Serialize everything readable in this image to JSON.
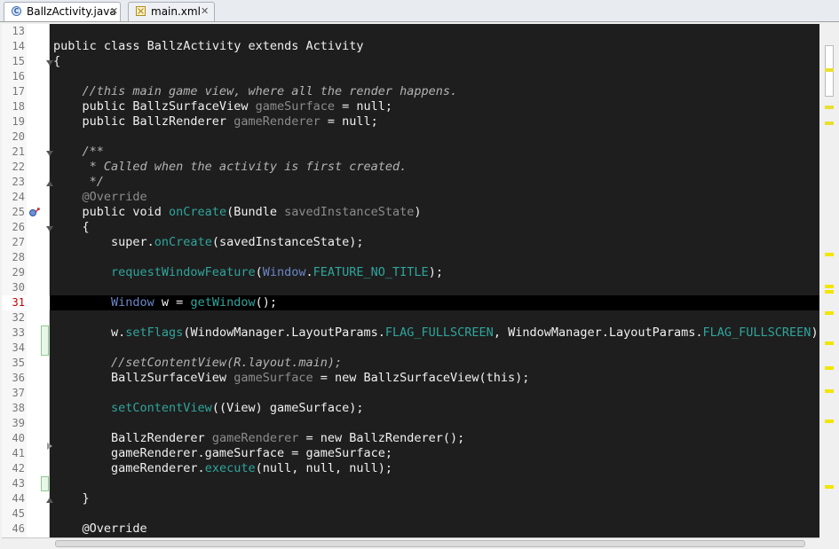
{
  "tabs": [
    {
      "label": "BallzActivity.java",
      "close": "✕",
      "icon": "java-class-icon",
      "active": true
    },
    {
      "label": "main.xml",
      "close": "✕",
      "icon": "xml-file-icon",
      "active": false
    }
  ],
  "current_line": "31",
  "lines": [
    {
      "n": "13",
      "code": []
    },
    {
      "n": "14",
      "code": [
        [
          "",
          "public class "
        ],
        [
          "",
          "BallzActivity"
        ],
        [
          "",
          " extends Activity"
        ]
      ]
    },
    {
      "n": "15",
      "code": [
        [
          "",
          "{"
        ]
      ]
    },
    {
      "n": "16",
      "code": []
    },
    {
      "n": "17",
      "code": [
        [
          "comment",
          "    //this main game view, where all the render happens."
        ]
      ]
    },
    {
      "n": "18",
      "code": [
        [
          "",
          "    public BallzSurfaceView "
        ],
        [
          "field",
          "gameSurface"
        ],
        [
          "",
          " = null;"
        ]
      ]
    },
    {
      "n": "19",
      "code": [
        [
          "",
          "    public BallzRenderer "
        ],
        [
          "field",
          "gameRenderer"
        ],
        [
          "",
          " = null;"
        ]
      ]
    },
    {
      "n": "20",
      "code": []
    },
    {
      "n": "21",
      "code": [
        [
          "comment",
          "    /**"
        ]
      ]
    },
    {
      "n": "22",
      "code": [
        [
          "comment",
          "     * Called when the activity is first created."
        ]
      ]
    },
    {
      "n": "23",
      "code": [
        [
          "comment",
          "     */"
        ]
      ]
    },
    {
      "n": "24",
      "code": [
        [
          "field",
          "    @Override"
        ]
      ]
    },
    {
      "n": "25",
      "code": [
        [
          "",
          "    public void "
        ],
        [
          "method",
          "onCreate"
        ],
        [
          "",
          "(Bundle "
        ],
        [
          "field",
          "savedInstanceState"
        ],
        [
          "",
          ")"
        ]
      ]
    },
    {
      "n": "26",
      "code": [
        [
          "",
          "    {"
        ]
      ]
    },
    {
      "n": "27",
      "code": [
        [
          "",
          "        super."
        ],
        [
          "method",
          "onCreate"
        ],
        [
          "",
          "(savedInstanceState);"
        ]
      ]
    },
    {
      "n": "28",
      "code": []
    },
    {
      "n": "29",
      "code": [
        [
          "method",
          "        requestWindowFeature"
        ],
        [
          "",
          "("
        ],
        [
          "type",
          "Window"
        ],
        [
          "",
          "."
        ],
        [
          "const",
          "FEATURE_NO_TITLE"
        ],
        [
          "",
          ");"
        ]
      ]
    },
    {
      "n": "30",
      "code": []
    },
    {
      "n": "31",
      "code": [
        [
          "type",
          "        Window"
        ],
        [
          "",
          " w = "
        ],
        [
          "method",
          "getWindow"
        ],
        [
          "",
          "();"
        ]
      ]
    },
    {
      "n": "32",
      "code": []
    },
    {
      "n": "33",
      "code": [
        [
          "",
          "        w."
        ],
        [
          "method",
          "setFlags"
        ],
        [
          "",
          "(WindowManager.LayoutParams."
        ],
        [
          "const",
          "FLAG_FULLSCREEN"
        ],
        [
          "",
          ", WindowManager.LayoutParams."
        ],
        [
          "const",
          "FLAG_FULLSCREEN"
        ],
        [
          "",
          ");"
        ]
      ]
    },
    {
      "n": "34",
      "code": []
    },
    {
      "n": "35",
      "code": [
        [
          "comment",
          "        //setContentView(R.layout.main);"
        ]
      ]
    },
    {
      "n": "36",
      "code": [
        [
          "",
          "        BallzSurfaceView "
        ],
        [
          "field",
          "gameSurface"
        ],
        [
          "",
          " = new BallzSurfaceView(this);"
        ]
      ]
    },
    {
      "n": "37",
      "code": []
    },
    {
      "n": "38",
      "code": [
        [
          "method",
          "        setContentView"
        ],
        [
          "",
          "((View) gameSurface);"
        ]
      ]
    },
    {
      "n": "39",
      "code": []
    },
    {
      "n": "40",
      "code": [
        [
          "",
          "        BallzRenderer "
        ],
        [
          "field",
          "gameRenderer"
        ],
        [
          "",
          " = new BallzRenderer();"
        ]
      ]
    },
    {
      "n": "41",
      "code": [
        [
          "",
          "        gameRenderer.gameSurface = gameSurface;"
        ]
      ]
    },
    {
      "n": "42",
      "code": [
        [
          "",
          "        gameRenderer."
        ],
        [
          "method",
          "execute"
        ],
        [
          "",
          "(null, null, null);"
        ]
      ]
    },
    {
      "n": "43",
      "code": []
    },
    {
      "n": "44",
      "code": [
        [
          "",
          "    }"
        ]
      ]
    },
    {
      "n": "45",
      "code": []
    },
    {
      "n": "46",
      "code": [
        [
          "",
          "    @Override"
        ]
      ]
    }
  ],
  "colors": {
    "background": "#1e1e1e",
    "comment": "#b4b4b4",
    "method": "#2fa59c",
    "type": "#6b86c9",
    "current_line_number": "#c00000",
    "warning_marker": "#f2e600"
  }
}
